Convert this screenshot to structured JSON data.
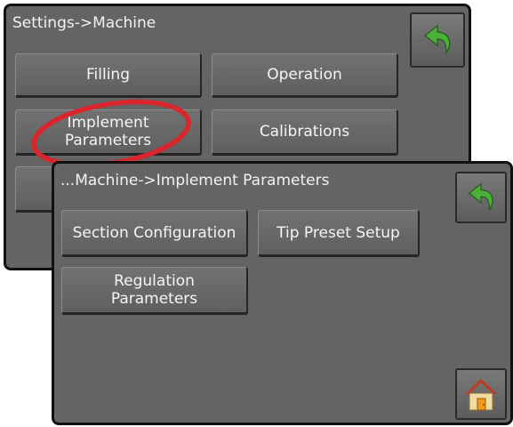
{
  "back_screen": {
    "title": "Settings->Machine",
    "buttons": [
      {
        "label": "Filling"
      },
      {
        "label": "Operation"
      },
      {
        "label": "Implement\nParameters"
      },
      {
        "label": "Calibrations"
      }
    ],
    "back_icon": "back-arrow-icon"
  },
  "front_screen": {
    "title": "...Machine->Implement Parameters",
    "buttons": [
      {
        "label": "Section Configuration"
      },
      {
        "label": "Tip Preset Setup"
      },
      {
        "label": "Regulation\nParameters"
      }
    ],
    "back_icon": "back-arrow-icon",
    "home_icon": "home-icon"
  },
  "colors": {
    "screen_bg": "#646464",
    "arrow": "#4caf3a",
    "highlight_ellipse": "#d8262c",
    "home_roof": "#c03a1e",
    "home_wall": "#f0dca0",
    "home_door": "#f29a1a"
  }
}
